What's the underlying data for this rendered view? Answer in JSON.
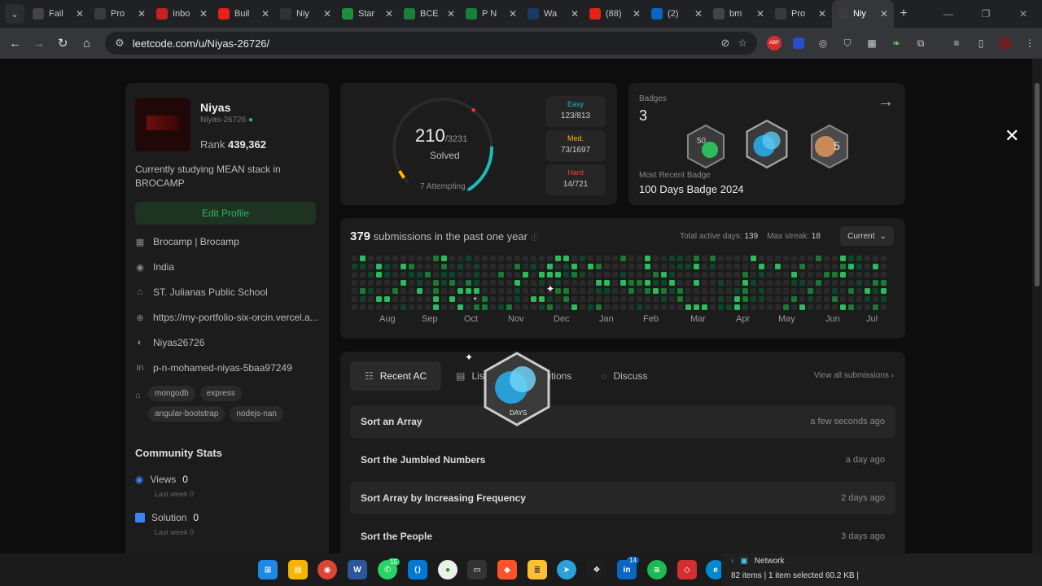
{
  "browser": {
    "tabs": [
      {
        "title": "Fail",
        "icon": "openai-icon",
        "color": "#444"
      },
      {
        "title": "Pro",
        "icon": "leetcode-icon",
        "color": "#3a3a3a"
      },
      {
        "title": "Inbo",
        "icon": "gmail-icon",
        "color": "#c5221f"
      },
      {
        "title": "Buil",
        "icon": "youtube-icon",
        "color": "#e62117"
      },
      {
        "title": "Niy",
        "icon": "github-icon",
        "color": "#333"
      },
      {
        "title": "Star",
        "icon": "drive-icon",
        "color": "#1e8e3e"
      },
      {
        "title": "BCE",
        "icon": "sheets-icon",
        "color": "#188038"
      },
      {
        "title": "P N",
        "icon": "sheets-icon",
        "color": "#188038"
      },
      {
        "title": "Wa",
        "icon": "hi-icon",
        "color": "#1a3a66"
      },
      {
        "title": "(88)",
        "icon": "youtube-icon",
        "color": "#e62117"
      },
      {
        "title": "(2)",
        "icon": "linkedin-icon",
        "color": "#0a66c2"
      },
      {
        "title": "bm",
        "icon": "google-icon",
        "color": "#444"
      },
      {
        "title": "Pro",
        "icon": "leetcode-icon",
        "color": "#3a3a3a"
      },
      {
        "title": "Niy",
        "icon": "leetcode-icon",
        "color": "#3a3a3a",
        "active": true
      }
    ],
    "url": "leetcode.com/u/Niyas-26726/"
  },
  "profile": {
    "name": "Niyas",
    "handle": "Niyas-26726",
    "rank_label": "Rank",
    "rank_value": "439,362",
    "bio": "Currently studying MEAN stack in BROCAMP",
    "edit_label": "Edit Profile",
    "info": [
      {
        "icon": "building-icon",
        "text": "Brocamp | Brocamp"
      },
      {
        "icon": "location-icon",
        "text": "India"
      },
      {
        "icon": "school-icon",
        "text": "ST. Julianas Public School"
      },
      {
        "icon": "globe-icon",
        "text": "https://my-portfolio-six-orcin.vercel.a..."
      },
      {
        "icon": "github-icon",
        "text": "Niyas26726"
      },
      {
        "icon": "linkedin-icon",
        "text": "p-n-mohamed-niyas-5baa97249"
      }
    ],
    "tags": [
      "mongodb",
      "express",
      "angular-bootstrap",
      "nodejs-nan"
    ],
    "community_title": "Community Stats",
    "views_label": "Views",
    "views_value": "0",
    "views_sub": "Last week 0",
    "solution_label": "Solution",
    "solution_value": "0",
    "solution_sub": "Last week 0"
  },
  "solved": {
    "count": "210",
    "total": "/3231",
    "label": "Solved",
    "attempting": "7 Attempting",
    "fraction": 0.065,
    "easy_label": "Easy",
    "easy_value": "123/813",
    "easy_color": "#1cbaba",
    "med_label": "Med.",
    "med_value": "73/1697",
    "med_color": "#ffb700",
    "hard_label": "Hard",
    "hard_value": "14/721",
    "hard_color": "#f63737"
  },
  "badges": {
    "label": "Badges",
    "count": "3",
    "recent_label": "Most Recent Badge",
    "recent_name": "100 Days Badge 2024"
  },
  "submissions": {
    "count": "379",
    "text": "submissions in the past one year",
    "active_label": "Total active days:",
    "active_value": "139",
    "streak_label": "Max streak:",
    "streak_value": "18",
    "current_label": "Current",
    "months": [
      "Aug",
      "Sep",
      "Oct",
      "Nov",
      "Dec",
      "Jan",
      "Feb",
      "Mar",
      "Apr",
      "May",
      "Jun",
      "Jul"
    ]
  },
  "recent": {
    "tabs": [
      {
        "label": "Recent AC",
        "icon": "list-check-icon"
      },
      {
        "label": "List",
        "icon": "document-icon"
      },
      {
        "label": "Solutions",
        "icon": "checkbox-icon"
      },
      {
        "label": "Discuss",
        "icon": "chat-icon"
      }
    ],
    "view_all": "View all submissions",
    "problems": [
      {
        "name": "Sort an Array",
        "time": "a few seconds ago"
      },
      {
        "name": "Sort the Jumbled Numbers",
        "time": "a day ago"
      },
      {
        "name": "Sort Array by Increasing Frequency",
        "time": "2 days ago"
      },
      {
        "name": "Sort the People",
        "time": "3 days ago"
      }
    ]
  },
  "popup_badge_text": "DAYS",
  "explorer": {
    "network_label": "Network",
    "status": "82 items  |  1 item selected  60.2 KB  |"
  },
  "taskbar_badges": {
    "whatsapp": "15",
    "linkedin": "14"
  }
}
